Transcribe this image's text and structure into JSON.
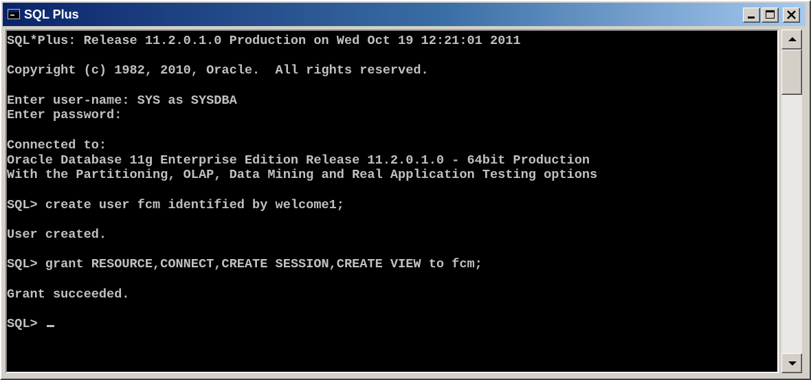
{
  "window": {
    "title": "SQL Plus",
    "icon": "console-window-icon",
    "controls": {
      "minimize": "minimize-icon",
      "maximize": "maximize-icon",
      "close": "close-icon"
    }
  },
  "console": {
    "lines": [
      "SQL*Plus: Release 11.2.0.1.0 Production on Wed Oct 19 12:21:01 2011",
      "",
      "Copyright (c) 1982, 2010, Oracle.  All rights reserved.",
      "",
      "Enter user-name: SYS as SYSDBA",
      "Enter password:",
      "",
      "Connected to:",
      "Oracle Database 11g Enterprise Edition Release 11.2.0.1.0 - 64bit Production",
      "With the Partitioning, OLAP, Data Mining and Real Application Testing options",
      "",
      "SQL> create user fcm identified by welcome1;",
      "",
      "User created.",
      "",
      "SQL> grant RESOURCE,CONNECT,CREATE SESSION,CREATE VIEW to fcm;",
      "",
      "Grant succeeded.",
      ""
    ],
    "prompt": "SQL> "
  },
  "colors": {
    "titlebar": "#0a246a",
    "console_background": "#000000",
    "console_text": "#c0c0c0"
  }
}
